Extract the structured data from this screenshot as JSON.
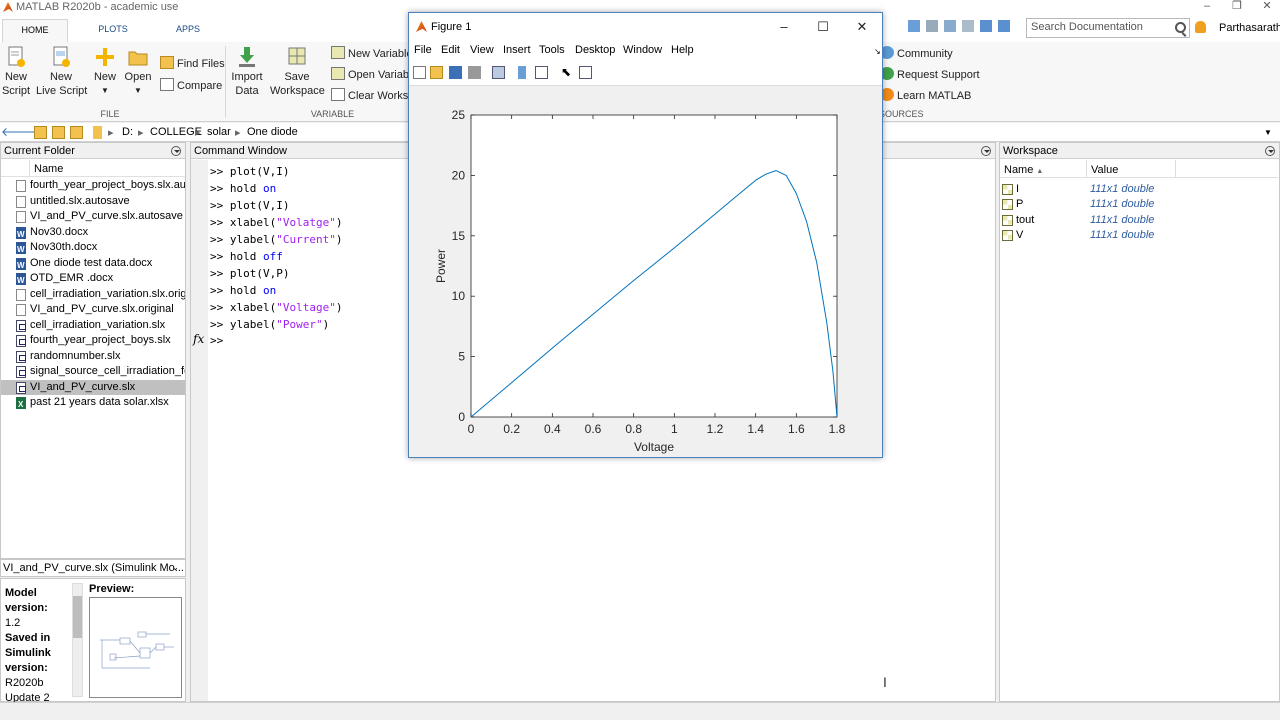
{
  "app": {
    "title": "MATLAB R2020b - academic use"
  },
  "ribbon": {
    "tabs": [
      {
        "label": "HOME"
      },
      {
        "label": "PLOTS"
      },
      {
        "label": "APPS"
      }
    ],
    "file_group": {
      "label": "FILE",
      "new_script": "New\nScript",
      "new_live_script": "New\nLive Script",
      "new": "New",
      "open": "Open",
      "find_files": "Find Files",
      "compare": "Compare"
    },
    "variable_group": {
      "label": "VARIABLE",
      "import_data": "Import\nData",
      "save_workspace": "Save\nWorkspace",
      "new_variable": "New Variable",
      "open_variable": "Open Variable",
      "clear_workspace": "Clear Workspace"
    },
    "resources_group": {
      "label": "RESOURCES",
      "community": "Community",
      "request_support": "Request Support",
      "learn_matlab": "Learn MATLAB"
    },
    "search_placeholder": "Search Documentation",
    "user": "Parthasarathy"
  },
  "address": {
    "path": [
      "D:",
      "COLLEGE",
      "solar",
      "One diode"
    ]
  },
  "current_folder": {
    "title": "Current Folder",
    "name_header": "Name",
    "files": [
      {
        "name": "fourth_year_project_boys.slx.autosave",
        "type": "orig"
      },
      {
        "name": "untitled.slx.autosave",
        "type": "orig"
      },
      {
        "name": "VI_and_PV_curve.slx.autosave",
        "type": "orig"
      },
      {
        "name": "Nov30.docx",
        "type": "docx"
      },
      {
        "name": "Nov30th.docx",
        "type": "docx"
      },
      {
        "name": "One diode test data.docx",
        "type": "docx"
      },
      {
        "name": "OTD_EMR .docx",
        "type": "docx"
      },
      {
        "name": "cell_irradiation_variation.slx.original",
        "type": "orig"
      },
      {
        "name": "VI_and_PV_curve.slx.original",
        "type": "orig"
      },
      {
        "name": "cell_irradiation_variation.slx",
        "type": "slx"
      },
      {
        "name": "fourth_year_project_boys.slx",
        "type": "slx"
      },
      {
        "name": "randomnumber.slx",
        "type": "slx"
      },
      {
        "name": "signal_source_cell_irradiation_forced",
        "type": "slx"
      },
      {
        "name": "VI_and_PV_curve.slx",
        "type": "slx",
        "selected": true
      },
      {
        "name": "past 21 years data solar.xlsx",
        "type": "xlsx"
      }
    ]
  },
  "details": {
    "header": "VI_and_PV_curve.slx  (Simulink Mo...",
    "lines": [
      "Model",
      "version:",
      "1.2",
      "Saved in",
      "Simulink",
      "version:",
      "R2020b",
      "Update 2"
    ],
    "bold_flags": [
      true,
      true,
      false,
      true,
      true,
      true,
      false,
      false
    ],
    "preview_label": "Preview:"
  },
  "command_window": {
    "title": "Command Window",
    "prompt": ">>",
    "fx": "fx",
    "lines": [
      {
        "code": "plot(V,I)",
        "kw": "",
        "str": ""
      },
      {
        "code": "hold ",
        "kw": "on",
        "str": ""
      },
      {
        "code": "plot(V,I)",
        "kw": "",
        "str": ""
      },
      {
        "code": "xlabel(",
        "kw": "",
        "str": "\"Volatge\"",
        "tail": ")"
      },
      {
        "code": "ylabel(",
        "kw": "",
        "str": "\"Current\"",
        "tail": ")"
      },
      {
        "code": "hold ",
        "kw": "off",
        "str": ""
      },
      {
        "code": "plot(V,P)",
        "kw": "",
        "str": ""
      },
      {
        "code": "hold ",
        "kw": "on",
        "str": ""
      },
      {
        "code": "xlabel(",
        "kw": "",
        "str": "\"Voltage\"",
        "tail": ")"
      },
      {
        "code": "ylabel(",
        "kw": "",
        "str": "\"Power\"",
        "tail": ")"
      }
    ]
  },
  "workspace": {
    "title": "Workspace",
    "col_name": "Name",
    "col_value": "Value",
    "vars": [
      {
        "name": "I",
        "value": "111x1 double"
      },
      {
        "name": "P",
        "value": "111x1 double"
      },
      {
        "name": "tout",
        "value": "111x1 double"
      },
      {
        "name": "V",
        "value": "111x1 double"
      }
    ]
  },
  "figure": {
    "title": "Figure 1",
    "menus": [
      "File",
      "Edit",
      "View",
      "Insert",
      "Tools",
      "Desktop",
      "Window",
      "Help"
    ]
  },
  "chart_data": {
    "type": "line",
    "title": "",
    "xlabel": "Voltage",
    "ylabel": "Power",
    "xlim": [
      0,
      1.8
    ],
    "ylim": [
      0,
      25
    ],
    "xticks": [
      0,
      0.2,
      0.4,
      0.6,
      0.8,
      1,
      1.2,
      1.4,
      1.6,
      1.8
    ],
    "yticks": [
      0,
      5,
      10,
      15,
      20,
      25
    ],
    "grid": false,
    "series": [
      {
        "color": "#0072bd",
        "x": [
          0,
          0.2,
          0.4,
          0.6,
          0.8,
          1.0,
          1.2,
          1.3,
          1.4,
          1.45,
          1.5,
          1.55,
          1.6,
          1.65,
          1.7,
          1.75,
          1.78,
          1.8
        ],
        "y": [
          0,
          2.85,
          5.7,
          8.5,
          11.3,
          14.0,
          16.8,
          18.2,
          19.6,
          20.1,
          20.4,
          20.0,
          18.5,
          16.2,
          12.8,
          7.8,
          3.8,
          0
        ]
      }
    ]
  }
}
